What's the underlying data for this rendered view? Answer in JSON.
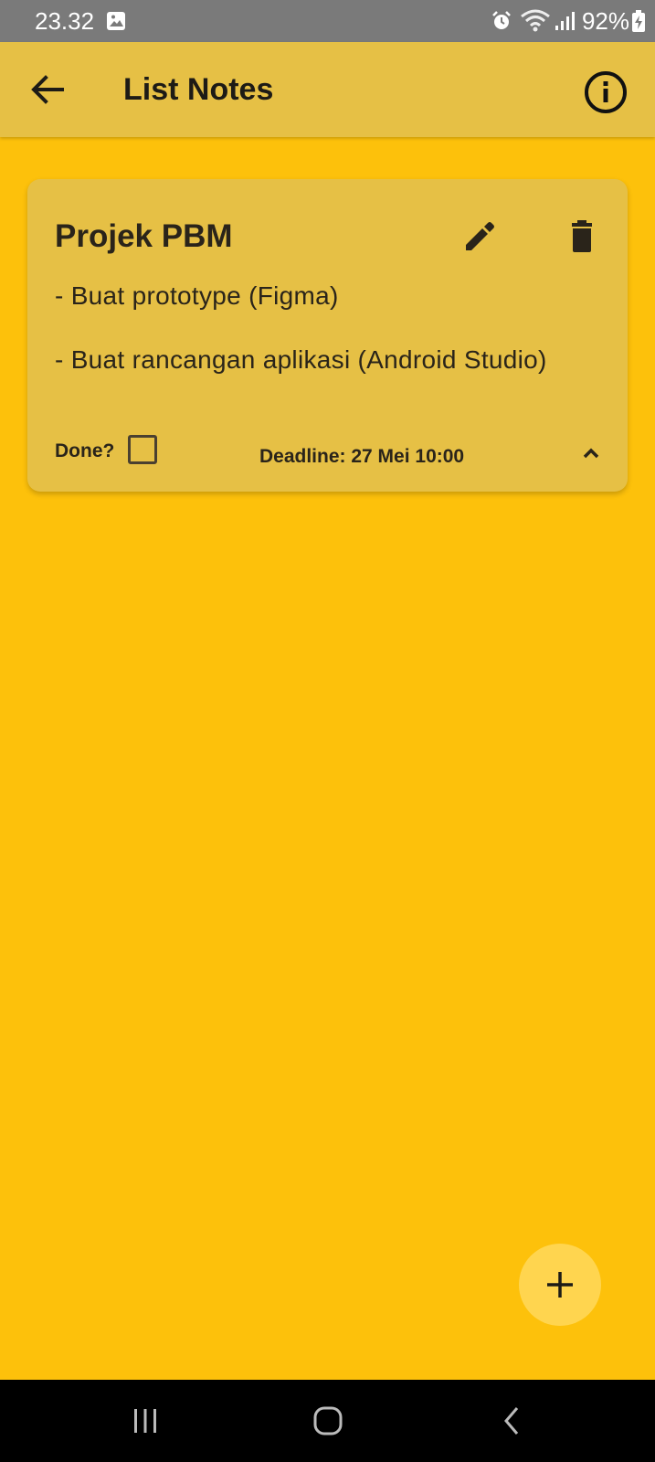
{
  "status_bar": {
    "time": "23.32",
    "battery": "92%",
    "icons": [
      "gallery-icon",
      "alarm-icon",
      "wifi-icon",
      "signal-icon",
      "battery-charging-icon"
    ]
  },
  "app_bar": {
    "title": "List Notes",
    "back_icon": "arrow-back-icon",
    "info_icon": "info-icon"
  },
  "note": {
    "title": "Projek PBM",
    "lines": [
      "- Buat prototype (Figma)",
      "- Buat rancangan aplikasi (Android Studio)"
    ],
    "done_label": "Done?",
    "done_checked": false,
    "deadline": "Deadline: 27 Mei 10:00",
    "edit_icon": "pencil-icon",
    "delete_icon": "trash-icon",
    "collapse_icon": "chevron-up-icon"
  },
  "fab": {
    "icon": "plus-icon"
  },
  "nav_bar": {
    "icons": [
      "recent-apps-icon",
      "home-icon",
      "back-icon"
    ]
  },
  "colors": {
    "background": "#FDC10B",
    "app_bar": "#E6C045",
    "card": "#E6C045",
    "fab": "#FFD54F",
    "status_bar": "#7A7A7A",
    "nav_bar": "#000000"
  }
}
